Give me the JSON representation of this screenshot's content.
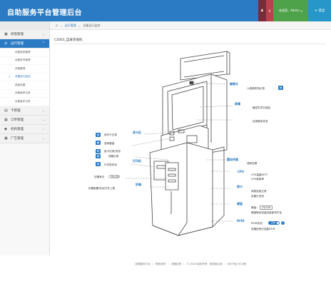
{
  "header": {
    "logo": "自助服务平台管理后台",
    "badge": "0",
    "welcome": "欢迎您，Admin",
    "exit_label": "退出"
  },
  "breadcrumb": {
    "items": [
      "运行管理",
      "设备运行监控"
    ]
  },
  "sidebar": {
    "menus": [
      {
        "label": "权限管理",
        "icon": "lock-icon",
        "active": false
      },
      {
        "label": "运行管理",
        "icon": "shuffle-icon",
        "active": true,
        "items": [
          "设备类型管理",
          "设备型号管理",
          "设备管理",
          "设备运行监控",
          "按错设置",
          "设备维修记录",
          "设备维护记录"
        ],
        "current_index": 3
      },
      {
        "label": "卡管理",
        "icon": "card-icon",
        "active": false
      },
      {
        "label": "订单管理",
        "icon": "calendar-icon",
        "active": false
      },
      {
        "label": "机构管理",
        "icon": "tag-icon",
        "active": false
      },
      {
        "label": "广告管理",
        "icon": "image-icon",
        "active": false
      }
    ]
  },
  "panel": {
    "title": "C2001_自发充值机"
  },
  "kiosk": {
    "categories": {
      "camera": "摄像头",
      "screen": "屏幕",
      "card_reader": "读卡区",
      "printer": "打印机",
      "cash": "钞箱",
      "vibration": "震动传感",
      "cpu": "CPU",
      "network": "网卡",
      "disk": "硬盘",
      "rfid": "RFID"
    },
    "labels": {
      "face_record": "人脸像抓拍记录",
      "touch_locate": "触控失灵已锁定",
      "app_state": "应用程序状态",
      "card_log": "读写卡记录",
      "pin_pad": "密码键盘",
      "card_swallow": "吞卡记录/关闭",
      "cash_record": "钱箱记录",
      "print_ok": "打印机状态",
      "cash_in": "钞箱有无",
      "cash_switch": "钞箱配置关闭/打开上限",
      "vibration_alert": "倾斜告警",
      "cpu_temp": "CPU温度80℃",
      "cpu_usage": "CPU使用率",
      "net_status": "网络连接正常",
      "net_shutdown": "设备已关机",
      "disk_prefix": "硬盘：",
      "disk_value": "23/100",
      "disk_note": "硬盘剩余容量容量即将不足",
      "rfid_status": "RFID状态：",
      "rfid_note": "设备检测已连接RFID",
      "toggle_off": "已关",
      "toggle_on": "正常"
    }
  },
  "footer": {
    "items": [
      "自助服务平台",
      "联系我们",
      "问题反馈",
      "© 2016 版本所有",
      "使用前必读",
      "京ICP证1301號"
    ]
  },
  "colors": {
    "accent": "#2b7bc4",
    "header_bg": "#2b7bc4",
    "user_bg": "#7a2b3a",
    "badge_bg": "#b8434f",
    "welcome_bg": "#4ea24a",
    "exit_bg": "#2796c8"
  }
}
